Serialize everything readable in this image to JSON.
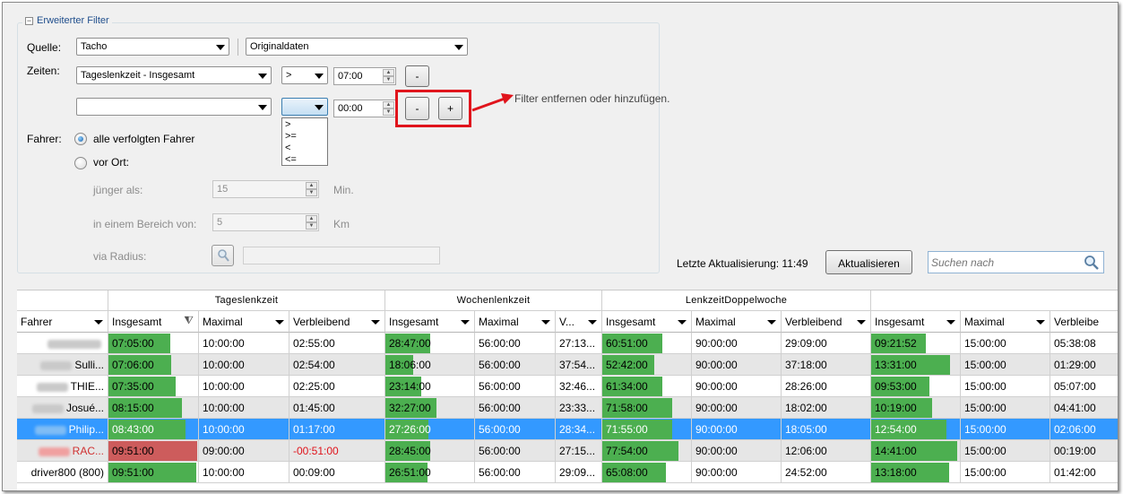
{
  "filter": {
    "legend": "Erweiterter Filter",
    "source_label": "Quelle:",
    "source_value": "Tacho",
    "source_type_value": "Originaldaten",
    "times_label": "Zeiten:",
    "row1": {
      "field": "Tageslenkzeit - Insgesamt",
      "operator": ">",
      "time": "07:00",
      "remove_label": "-"
    },
    "row2": {
      "field": "",
      "operator": "",
      "time": "00:00",
      "remove_label": "-",
      "add_label": "+"
    },
    "operator_options": [
      ">",
      ">=",
      "<",
      "<="
    ],
    "annotation": "Filter entfernen oder hinzufügen.",
    "driver_label": "Fahrer:",
    "driver_opt_all": "alle verfolgten Fahrer",
    "driver_opt_local": "vor Ort:",
    "younger_label": "jünger als:",
    "younger_value": "15",
    "younger_unit": "Min.",
    "area_label": "in einem Bereich von:",
    "area_value": "5",
    "area_unit": "Km",
    "radius_label": "via Radius:"
  },
  "toolbar": {
    "last_update": "Letzte Aktualisierung: 11:49",
    "refresh_label": "Aktualisieren",
    "search_placeholder": "Suchen nach"
  },
  "colors": {
    "accent": "#3399ff",
    "bar_green": "#4caf50",
    "bar_red": "#cd5c5c",
    "highlight": "#e0141c"
  },
  "table": {
    "groups": [
      "Tageslenkzeit",
      "Wochenlenkzeit",
      "LenkzeitDoppelwoche",
      ""
    ],
    "columns": [
      "Fahrer",
      "Insgesamt",
      "Maximal",
      "Verbleibend",
      "Insgesamt",
      "Maximal",
      "V...",
      "Insgesamt",
      "Maximal",
      "Verbleibend",
      "Insgesamt",
      "Maximal",
      "Verbleibe"
    ],
    "rows": [
      {
        "name": "",
        "state": "normal",
        "cells": [
          "07:05:00",
          "10:00:00",
          "02:55:00",
          "28:47:00",
          "56:00:00",
          "27:13...",
          "60:51:00",
          "90:00:00",
          "29:09:00",
          "09:21:52",
          "15:00:00",
          "05:38:08"
        ],
        "bars": [
          0.7,
          0.51,
          0.68,
          0.62
        ]
      },
      {
        "name": "Sulli...",
        "state": "normal",
        "cells": [
          "07:06:00",
          "10:00:00",
          "02:54:00",
          "18:06:00",
          "56:00:00",
          "37:54...",
          "52:42:00",
          "90:00:00",
          "37:18:00",
          "13:31:00",
          "15:00:00",
          "01:29:00"
        ],
        "bars": [
          0.71,
          0.32,
          0.59,
          0.9
        ]
      },
      {
        "name": "THIE...",
        "state": "normal",
        "cells": [
          "07:35:00",
          "10:00:00",
          "02:25:00",
          "23:14:00",
          "56:00:00",
          "32:46...",
          "61:34:00",
          "90:00:00",
          "28:26:00",
          "09:53:00",
          "15:00:00",
          "05:07:00"
        ],
        "bars": [
          0.76,
          0.41,
          0.68,
          0.66
        ]
      },
      {
        "name": "Josué...",
        "state": "normal",
        "cells": [
          "08:15:00",
          "10:00:00",
          "01:45:00",
          "32:27:00",
          "56:00:00",
          "23:33...",
          "71:58:00",
          "90:00:00",
          "18:02:00",
          "10:19:00",
          "15:00:00",
          "04:41:00"
        ],
        "bars": [
          0.83,
          0.58,
          0.8,
          0.69
        ]
      },
      {
        "name": "Philip...",
        "state": "selected",
        "cells": [
          "08:43:00",
          "10:00:00",
          "01:17:00",
          "27:26:00",
          "56:00:00",
          "28:34...",
          "71:55:00",
          "90:00:00",
          "18:05:00",
          "12:54:00",
          "15:00:00",
          "02:06:00"
        ],
        "bars": [
          0.87,
          0.49,
          0.8,
          0.86
        ]
      },
      {
        "name": "RAC...",
        "state": "alert",
        "cells": [
          "09:51:00",
          "09:00:00",
          "-00:51:00",
          "28:45:00",
          "56:00:00",
          "27:15...",
          "77:54:00",
          "90:00:00",
          "12:06:00",
          "14:41:00",
          "15:00:00",
          "00:19:00"
        ],
        "bars": [
          1.0,
          0.51,
          0.87,
          0.98
        ]
      },
      {
        "name": "driver800  (800)",
        "state": "normal",
        "cells": [
          "09:51:00",
          "10:00:00",
          "00:09:00",
          "26:51:00",
          "56:00:00",
          "29:09...",
          "65:08:00",
          "90:00:00",
          "24:52:00",
          "13:18:00",
          "15:00:00",
          "01:42:00"
        ],
        "bars": [
          0.99,
          0.48,
          0.72,
          0.89
        ]
      }
    ]
  }
}
